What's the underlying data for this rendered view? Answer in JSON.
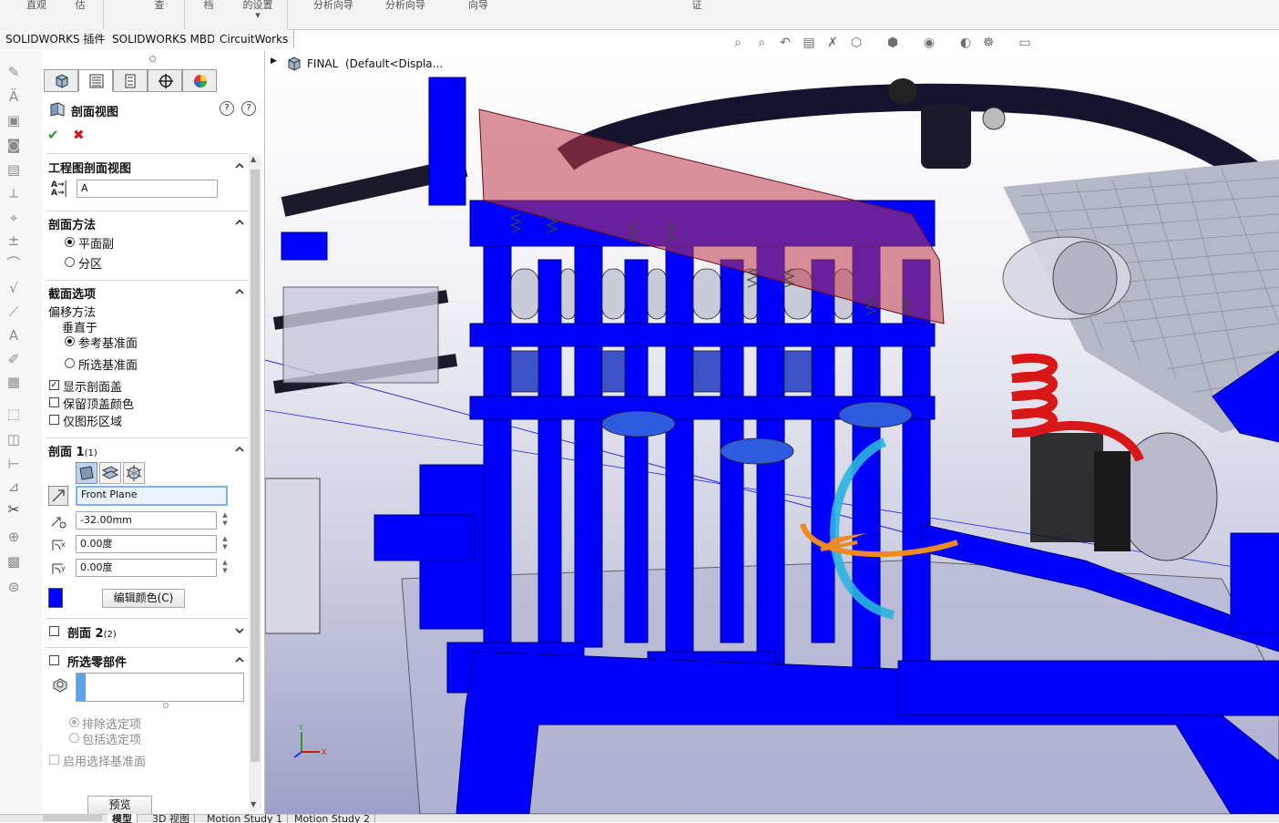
{
  "ribbon": {
    "groups": [
      "直观",
      "估",
      "查",
      "档",
      "的设置",
      "分析向导",
      "分析向导",
      "向导",
      "证"
    ]
  },
  "tabs": [
    "SOLIDWORKS 插件",
    "SOLIDWORKS MBD",
    "CircuitWorks"
  ],
  "breadcrumb": {
    "text": "FINAL  (Default<Displa..."
  },
  "panel": {
    "title": "剖面视图",
    "ok_icon": "check-icon",
    "cancel_icon": "x-icon",
    "section_drawing": {
      "header": "工程图剖面视图",
      "label_value": "A"
    },
    "section_method": {
      "header": "剖面方法",
      "opt_plane": "平面副",
      "opt_zone": "分区"
    },
    "section_options": {
      "header": "截面选项",
      "offset_method": "偏移方法",
      "normal_to": "垂直于",
      "opt_reference_plane": "参考基准面",
      "opt_selected_plane": "所选基准面",
      "show_cap": "显示剖面盖",
      "keep_cap_color": "保留顶盖颜色",
      "graphics_only": "仅图形区域"
    },
    "section1": {
      "header": "剖面 1",
      "header_count": "(1)",
      "plane": "Front Plane",
      "offset": "-32.00mm",
      "angle_x": "0.00度",
      "angle_y": "0.00度",
      "cap_color": "#0000ff",
      "edit_color": "编辑颜色(C)"
    },
    "section2": {
      "header": "剖面 2",
      "header_count": "(2)"
    },
    "selected_components": {
      "header": "所选零部件",
      "exclude": "排除选定项",
      "include": "包括选定项",
      "enable_select_plane": "启用选择基准面"
    },
    "preview_button": "预览"
  },
  "bottom_tabs": [
    "模型",
    "3D 视图",
    "Motion Study 1",
    "Motion Study 2"
  ],
  "colors": {
    "section_blue": "#0000ff",
    "accent_blue": "#7fb2e5"
  }
}
